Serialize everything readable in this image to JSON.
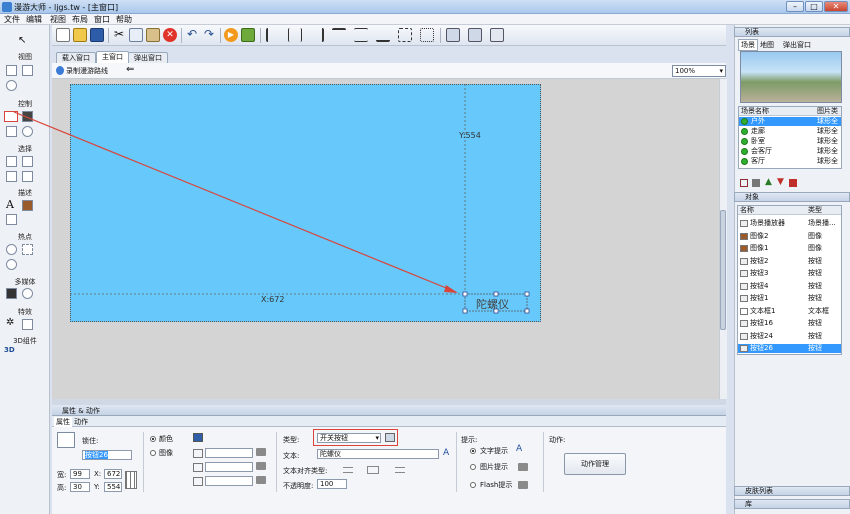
{
  "window": {
    "title": "漫游大师 - ljgs.tw - [主窗口]",
    "minimize": "–",
    "maximize": "□",
    "close": "✕"
  },
  "menu": [
    "文件",
    "编辑",
    "视图",
    "布局",
    "窗口",
    "帮助"
  ],
  "left_panel": {
    "sections": [
      "视图",
      "控制",
      "选择",
      "描述",
      "热点",
      "多媒体",
      "特效",
      "3D组件"
    ]
  },
  "tabs": [
    "载入窗口",
    "主窗口",
    "弹出窗口"
  ],
  "doc_toolbar": {
    "record_label": "录制漫游路线",
    "zoom": "100%"
  },
  "canvas": {
    "y_label": "Y:554",
    "x_label": "X:672",
    "gyro_text": "陀螺仪"
  },
  "properties": {
    "header": "属性 & 动作",
    "tabs": [
      "属性",
      "动作"
    ],
    "lock_label": "锁住:",
    "name_value": "按钮26",
    "width_label": "宽:",
    "width_value": "99",
    "height_label": "高:",
    "height_value": "30",
    "x_label": "X:",
    "x_value": "672",
    "y_label": "Y:",
    "y_value": "554",
    "color_label": "颜色",
    "image_label": "图像",
    "type_label": "类型:",
    "type_value": "开关按钮",
    "text_label": "文本:",
    "text_value": "陀螺仪",
    "align_label": "文本对齐类型:",
    "opacity_label": "不透明度:",
    "opacity_value": "100",
    "hint_label": "提示:",
    "hint_text": "文字提示",
    "hint_image": "图片提示",
    "hint_flash": "Flash提示",
    "action_label": "动作:",
    "action_button": "动作管理"
  },
  "right_panel": {
    "list_header": "列表",
    "list_tabs": [
      "场景",
      "地图",
      "弹出窗口"
    ],
    "scene_cols": [
      "场景名称",
      "图片类"
    ],
    "scenes": [
      {
        "name": "户外",
        "type": "球形全"
      },
      {
        "name": "走廊",
        "type": "球形全"
      },
      {
        "name": "卧室",
        "type": "球形全"
      },
      {
        "name": "会客厅",
        "type": "球形全"
      },
      {
        "name": "客厅",
        "type": "球形全"
      }
    ],
    "objects_header": "对象",
    "object_cols": [
      "名称",
      "类型"
    ],
    "objects": [
      {
        "name": "场景播放器",
        "type": "场景播..."
      },
      {
        "name": "图像2",
        "type": "图像"
      },
      {
        "name": "图像1",
        "type": "图像"
      },
      {
        "name": "按钮2",
        "type": "按钮"
      },
      {
        "name": "按钮3",
        "type": "按钮"
      },
      {
        "name": "按钮4",
        "type": "按钮"
      },
      {
        "name": "按钮1",
        "type": "按钮"
      },
      {
        "name": "文本框1",
        "type": "文本框"
      },
      {
        "name": "按钮16",
        "type": "按钮"
      },
      {
        "name": "按钮24",
        "type": "按钮"
      },
      {
        "name": "按钮26",
        "type": "按钮"
      }
    ],
    "skin_list": "皮肤列表",
    "library": "库"
  },
  "colors": {
    "scene": "#66c8fb",
    "selection": "#3399ff",
    "annotation": "#d9453b"
  }
}
